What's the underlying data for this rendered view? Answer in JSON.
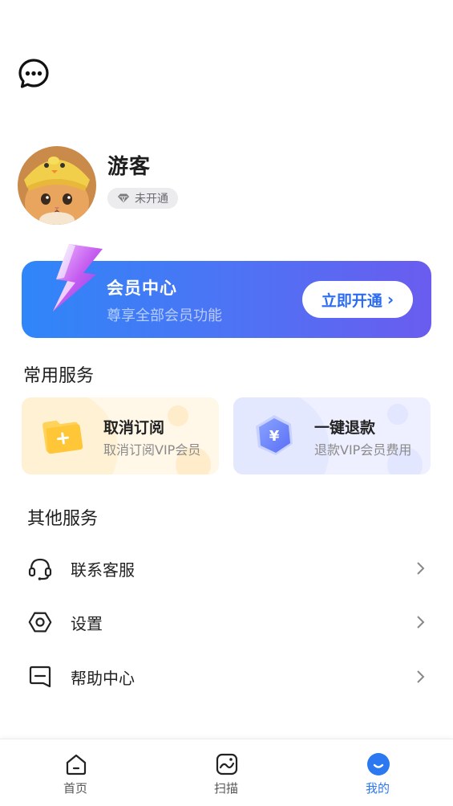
{
  "profile": {
    "username": "游客",
    "vip_status": "未开通"
  },
  "vip_banner": {
    "title": "会员中心",
    "subtitle": "尊享全部会员功能",
    "button_label": "立即开通"
  },
  "common_services": {
    "title": "常用服务",
    "items": [
      {
        "title": "取消订阅",
        "subtitle": "取消订阅VIP会员",
        "icon": "folder-plus-icon"
      },
      {
        "title": "一键退款",
        "subtitle": "退款VIP会员费用",
        "icon": "yen-hexagon-icon"
      }
    ]
  },
  "other_services": {
    "title": "其他服务",
    "items": [
      {
        "label": "联系客服",
        "icon": "headset-icon"
      },
      {
        "label": "设置",
        "icon": "settings-hexagon-icon"
      },
      {
        "label": "帮助中心",
        "icon": "help-icon"
      }
    ]
  },
  "tabbar": {
    "items": [
      {
        "label": "首页",
        "icon": "home-icon",
        "active": false
      },
      {
        "label": "扫描",
        "icon": "scan-icon",
        "active": false
      },
      {
        "label": "我的",
        "icon": "profile-icon",
        "active": true
      }
    ]
  },
  "colors": {
    "accent": "#2b78f0",
    "banner_start": "#2f86f8",
    "banner_end": "#6a5cef",
    "cancel_card_bg": "#fff7e8",
    "refund_card_bg": "#eef0ff"
  }
}
